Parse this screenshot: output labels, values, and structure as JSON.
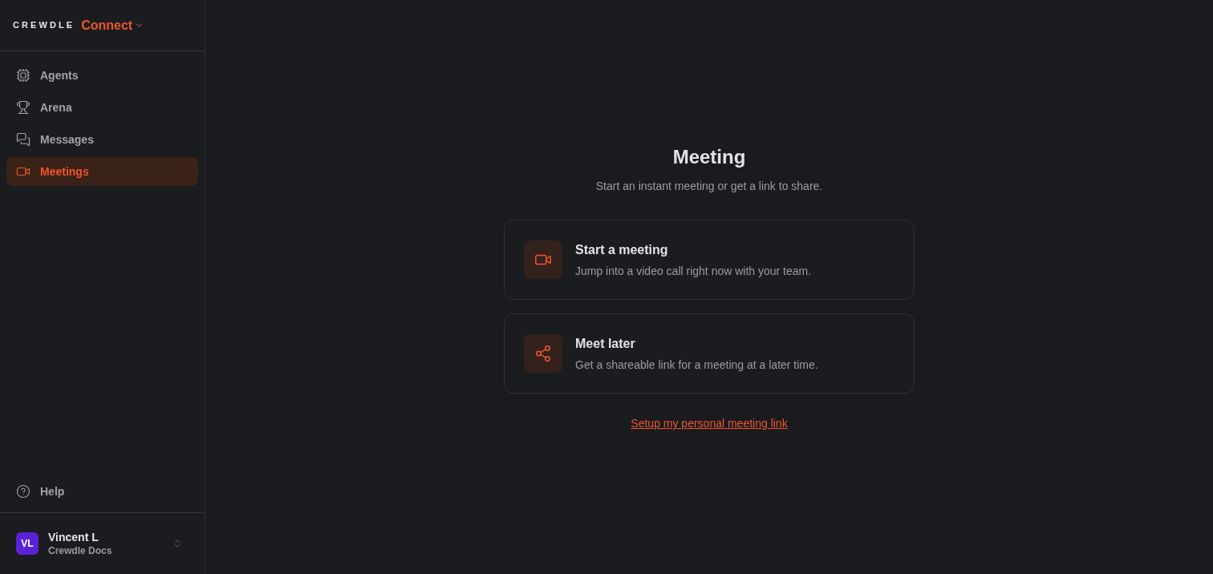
{
  "brand": {
    "logo": "CREWDLE",
    "product": "Connect"
  },
  "nav": [
    {
      "label": "Agents",
      "selected": false
    },
    {
      "label": "Arena",
      "selected": false
    },
    {
      "label": "Messages",
      "selected": false
    },
    {
      "label": "Meetings",
      "selected": true
    }
  ],
  "help": {
    "label": "Help"
  },
  "user": {
    "initials": "VL",
    "name": "Vincent L",
    "org": "Crewdle Docs"
  },
  "page": {
    "title": "Meeting",
    "subtitle": "Start an instant meeting or get a link to share."
  },
  "options": [
    {
      "title": "Start a meeting",
      "description": "Jump into a video call right now with your team."
    },
    {
      "title": "Meet later",
      "description": "Get a shareable link for a meeting at a later time."
    }
  ],
  "link": "Setup my personal meeting link"
}
